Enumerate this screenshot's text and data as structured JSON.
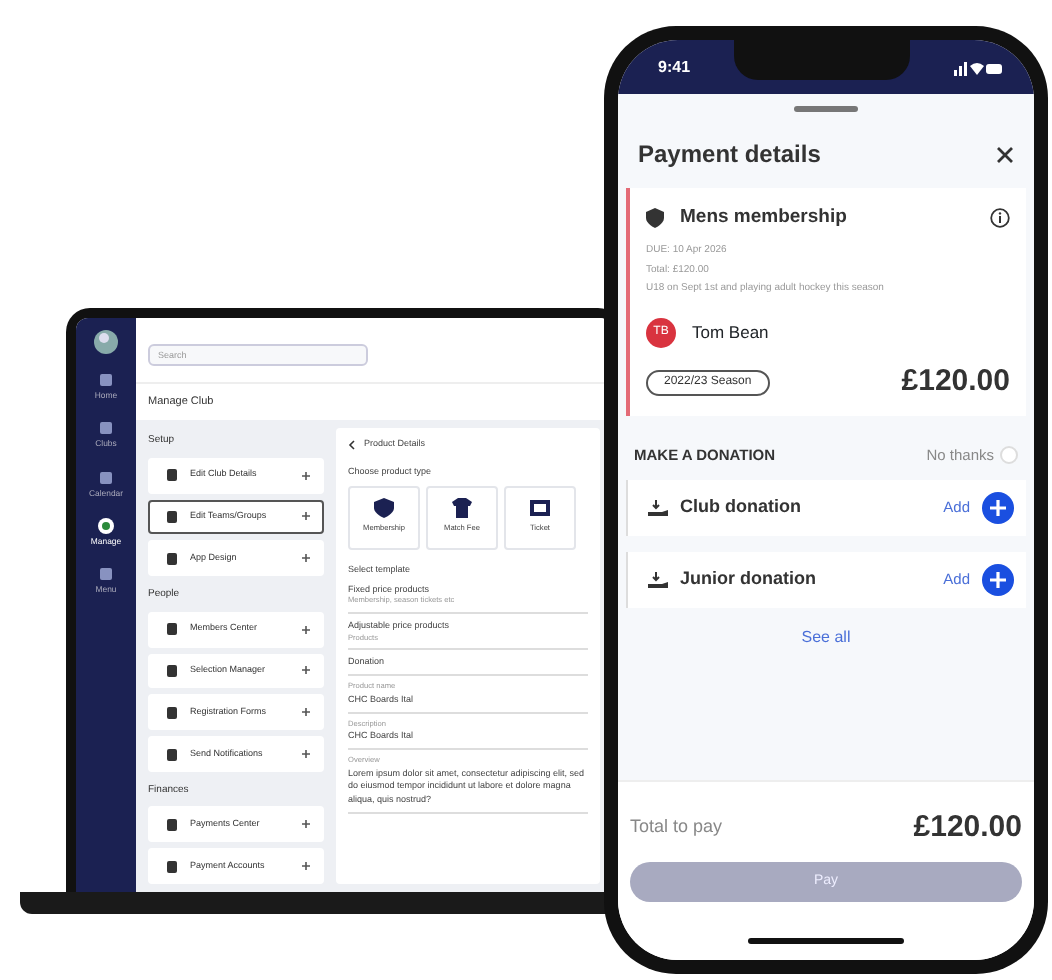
{
  "laptop": {
    "sidebar": [
      {
        "label": "Home",
        "selected": false
      },
      {
        "label": "Clubs",
        "selected": false
      },
      {
        "label": "Calendar",
        "selected": false
      },
      {
        "label": "Manage",
        "selected": true
      },
      {
        "label": "Menu",
        "selected": false
      }
    ],
    "search": {
      "placeholder": "Search"
    },
    "title": "Manage Club",
    "sections": [
      {
        "title": "Setup",
        "items": [
          {
            "label": "Edit Club Details",
            "selected": false
          },
          {
            "label": "Edit Teams/Groups",
            "selected": true
          },
          {
            "label": "App Design",
            "selected": false
          }
        ]
      },
      {
        "title": "People",
        "items": [
          {
            "label": "Members Center",
            "selected": false
          },
          {
            "label": "Selection Manager",
            "selected": false
          },
          {
            "label": "Registration Forms",
            "selected": false
          },
          {
            "label": "Send Notifications",
            "selected": false
          }
        ]
      },
      {
        "title": "Finances",
        "items": [
          {
            "label": "Payments Center",
            "selected": false
          },
          {
            "label": "Payment Accounts",
            "selected": false
          }
        ]
      }
    ],
    "product": {
      "back": "Product Details",
      "type_heading": "Choose product type",
      "types": [
        {
          "label": "Membership"
        },
        {
          "label": "Match Fee"
        },
        {
          "label": "Ticket"
        }
      ],
      "template_heading": "Select template",
      "templates": [
        {
          "title": "Fixed price products",
          "hint": "Membership, season tickets etc"
        },
        {
          "title": "Adjustable price products",
          "hint": "Products"
        },
        {
          "title": "Donation"
        }
      ],
      "fields": [
        {
          "label": "Product name",
          "value": "CHC Boards Ital"
        },
        {
          "label": "Description",
          "value": "CHC Boards Ital"
        },
        {
          "label": "Overview",
          "value": "Lorem ipsum dolor sit amet, consectetur adipiscing elit, sed do eiusmod tempor incididunt ut labore et dolore magna aliqua, quis nostrud?"
        }
      ]
    }
  },
  "phone": {
    "time": "9:41",
    "title": "Payment details",
    "membership": {
      "name": "Mens membership",
      "lines": [
        "DUE: 10 Apr 2026",
        "Total: £120.00",
        "U18 on Sept 1st and playing adult hockey this season"
      ],
      "initials": "TB",
      "member": "Tom Bean",
      "season": "2022/23 Season",
      "price": "£120.00"
    },
    "donation_heading": "MAKE A DONATION",
    "no_thanks": {
      "label": "No thanks",
      "checked": false
    },
    "donations": [
      {
        "name": "Club donation",
        "action": "Add"
      },
      {
        "name": "Junior donation",
        "action": "Add"
      }
    ],
    "see_all": "See all",
    "total_label": "Total to pay",
    "total": "£120.00",
    "pay": {
      "label": "Pay",
      "disabled": true
    }
  }
}
